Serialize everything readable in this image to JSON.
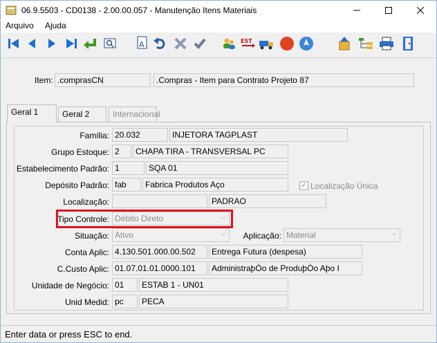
{
  "window": {
    "title": "06.9.5503 - CD0138 - 2.00.00.057 - Manutenção Itens Materiais"
  },
  "menu": {
    "arquivo": "Arquivo",
    "ajuda": "Ajuda"
  },
  "header": {
    "item_label": "Item:",
    "item_code": ".comprasCN",
    "item_desc": ".Compras - Item para Contrato Projeto 87"
  },
  "tabs": [
    {
      "label": "Geral 1"
    },
    {
      "label": "Geral 2"
    },
    {
      "label": "Internacional"
    }
  ],
  "form": {
    "familia": {
      "label": "Família:",
      "code": "20.032",
      "desc": "INJETORA TAGPLAST"
    },
    "grupo_estoque": {
      "label": "Grupo Estoque:",
      "code": "2",
      "desc": "CHAPA TIRA   - TRANSVERSAL  PC"
    },
    "estabelecimento": {
      "label": "Estabelecimento Padrão:",
      "code": "1",
      "desc": "SQA 01"
    },
    "deposito": {
      "label": "Depósito Padrão:",
      "code": "fab",
      "desc": "Fabrica Produtos Aço"
    },
    "localizacao_unica": {
      "label": "Localização Única",
      "checked": true
    },
    "localizacao": {
      "label": "Localização:",
      "code": "",
      "desc": "PADRAO"
    },
    "tipo_controle": {
      "label": "Tipo Controle:",
      "value": "Débito Direto"
    },
    "situacao": {
      "label": "Situação:",
      "value": "Ativo"
    },
    "aplicacao": {
      "label": "Aplicação:",
      "value": "Material"
    },
    "conta_aplic": {
      "label": "Conta Aplic:",
      "code": "4.130.501.000.00.502",
      "desc": "Entrega Futura (despesa)"
    },
    "ccusto_aplic": {
      "label": "C.Custo Aplic:",
      "code": "01.07.01.01.0000.101",
      "desc": "AdministraþÒo de ProduþÒo Aþo I"
    },
    "unidade_negocio": {
      "label": "Unidade de Negócio:",
      "code": "01",
      "desc": "ESTAB 1 - UN01"
    },
    "unid_medid": {
      "label": "Unid Medid:",
      "code": "pc",
      "desc": "PECA"
    }
  },
  "status": {
    "text": "Enter data or press ESC to end."
  },
  "icons": {
    "toolbar": [
      "first-icon",
      "prev-icon",
      "next-icon",
      "last-icon",
      "goto-icon",
      "search-icon",
      "rename-icon",
      "undo-icon",
      "cancel-icon",
      "confirm-icon",
      "users-icon",
      "est-icon",
      "truck-icon",
      "stop-icon",
      "navigate-icon",
      "upload-icon",
      "tree-icon",
      "print-icon",
      "exit-icon"
    ]
  }
}
